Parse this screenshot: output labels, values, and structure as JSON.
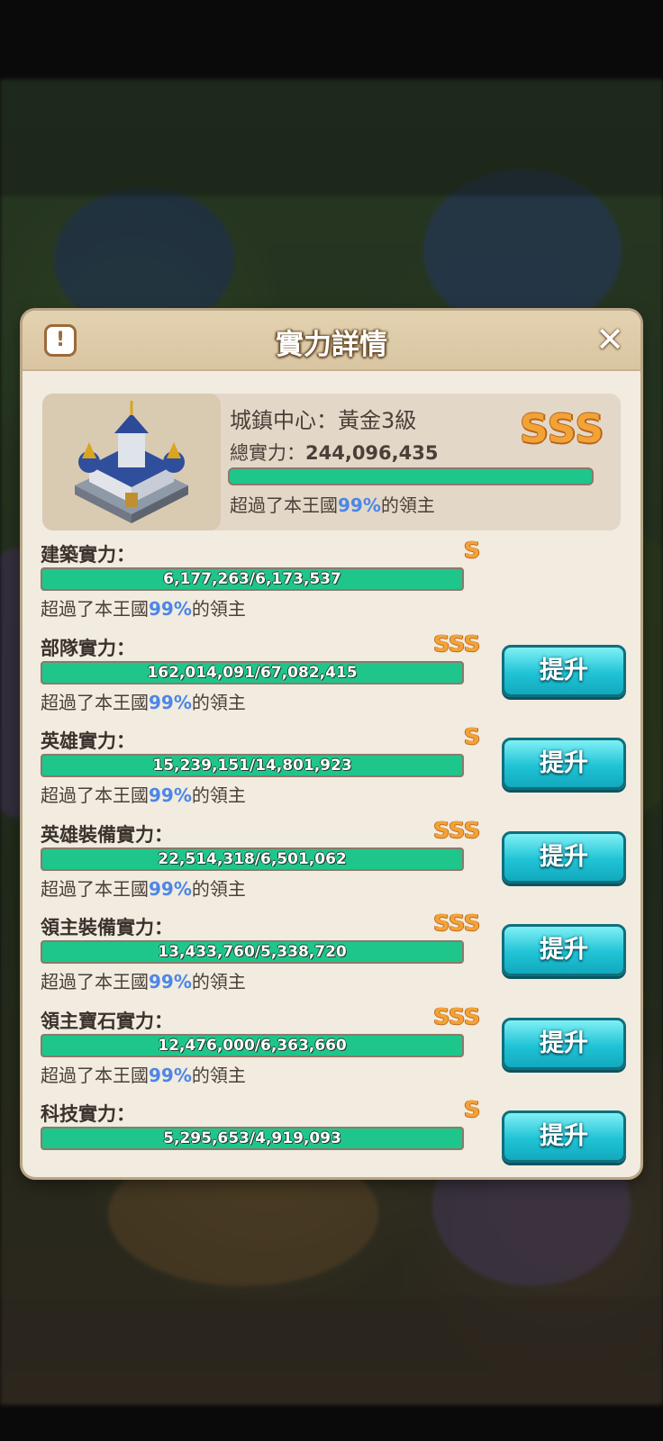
{
  "panel": {
    "title": "實力詳情",
    "info_icon": "!",
    "close_icon": "✕"
  },
  "summary": {
    "title": "城鎮中心：黃金3級",
    "total_label": "總實力：",
    "total_value": "244,096,435",
    "grade": "SSS",
    "progress": 1.0,
    "pct_prefix": "超過了本王國",
    "pct_value": "99%",
    "pct_suffix": "的領主"
  },
  "stats": [
    {
      "label": "建築實力：",
      "grade": "S",
      "value": "6,177,263/6,173,537",
      "progress": 1.0,
      "pct_prefix": "超過了本王國",
      "pct_value": "99%",
      "pct_suffix": "的領主",
      "has_button": false
    },
    {
      "label": "部隊實力：",
      "grade": "SSS",
      "value": "162,014,091/67,082,415",
      "progress": 1.0,
      "pct_prefix": "超過了本王國",
      "pct_value": "99%",
      "pct_suffix": "的領主",
      "has_button": true,
      "button": "提升"
    },
    {
      "label": "英雄實力：",
      "grade": "S",
      "value": "15,239,151/14,801,923",
      "progress": 1.0,
      "pct_prefix": "超過了本王國",
      "pct_value": "99%",
      "pct_suffix": "的領主",
      "has_button": true,
      "button": "提升"
    },
    {
      "label": "英雄裝備實力：",
      "grade": "SSS",
      "value": "22,514,318/6,501,062",
      "progress": 1.0,
      "pct_prefix": "超過了本王國",
      "pct_value": "99%",
      "pct_suffix": "的領主",
      "has_button": true,
      "button": "提升"
    },
    {
      "label": "領主裝備實力：",
      "grade": "SSS",
      "value": "13,433,760/5,338,720",
      "progress": 1.0,
      "pct_prefix": "超過了本王國",
      "pct_value": "99%",
      "pct_suffix": "的領主",
      "has_button": true,
      "button": "提升"
    },
    {
      "label": "領主寶石實力：",
      "grade": "SSS",
      "value": "12,476,000/6,363,660",
      "progress": 1.0,
      "pct_prefix": "超過了本王國",
      "pct_value": "99%",
      "pct_suffix": "的領主",
      "has_button": true,
      "button": "提升"
    },
    {
      "label": "科技實力：",
      "grade": "S",
      "value": "5,295,653/4,919,093",
      "progress": 1.0,
      "pct_prefix": "",
      "pct_value": "",
      "pct_suffix": "",
      "has_button": true,
      "button": "提升"
    }
  ],
  "colors": {
    "progress_fill": "#1ec68c",
    "grade": "#f3a235",
    "percent_highlight": "#4d86e6",
    "button": "#20c3d6"
  }
}
